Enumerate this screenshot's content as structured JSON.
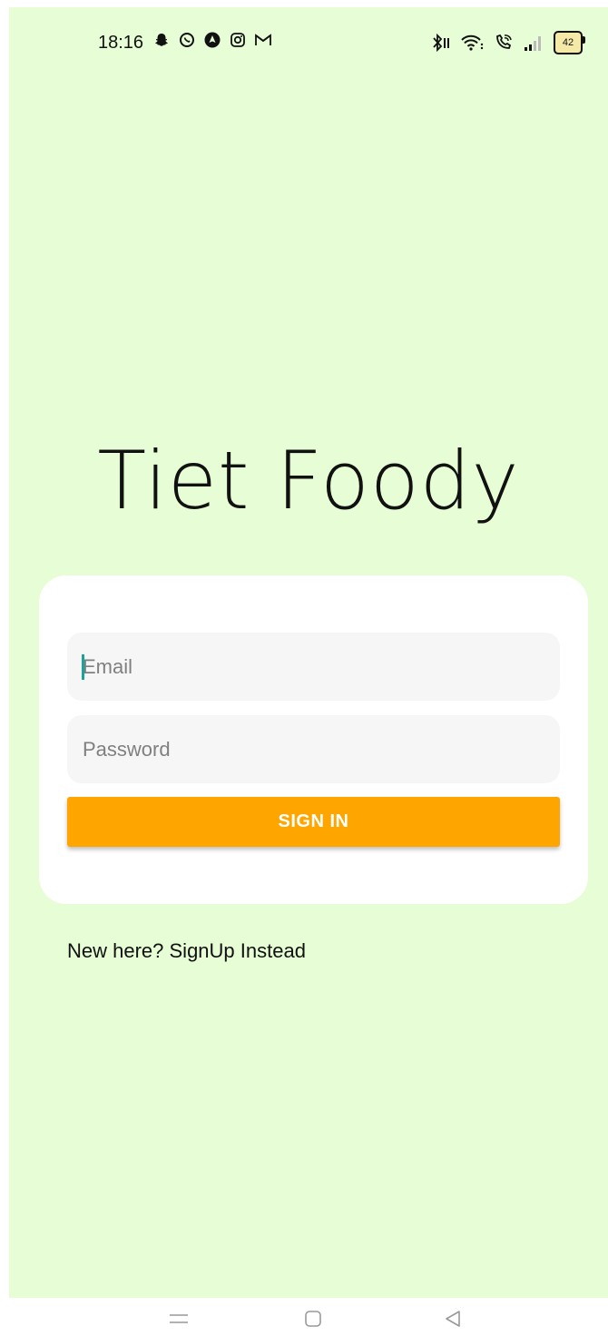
{
  "status_bar": {
    "time": "18:16",
    "notification_icons": [
      "snapchat-icon",
      "whatsapp-icon",
      "navigation-icon",
      "instagram-icon",
      "gmail-icon"
    ],
    "system_icons": [
      "bluetooth-icon",
      "wifi-icon",
      "wifi-calling-icon",
      "signal-icon"
    ],
    "battery_level": "42"
  },
  "app": {
    "title": "Tiet Foody"
  },
  "login_form": {
    "email_placeholder": "Email",
    "password_placeholder": "Password",
    "sign_in_label": "SIGN IN"
  },
  "signup_link": "New here? SignUp Instead",
  "nav_bar": {
    "buttons": [
      "menu-icon",
      "home-icon",
      "back-icon"
    ]
  },
  "colors": {
    "background": "#e7fdd5",
    "card": "#ffffff",
    "button": "#ffa500",
    "cursor": "#1aa399"
  }
}
